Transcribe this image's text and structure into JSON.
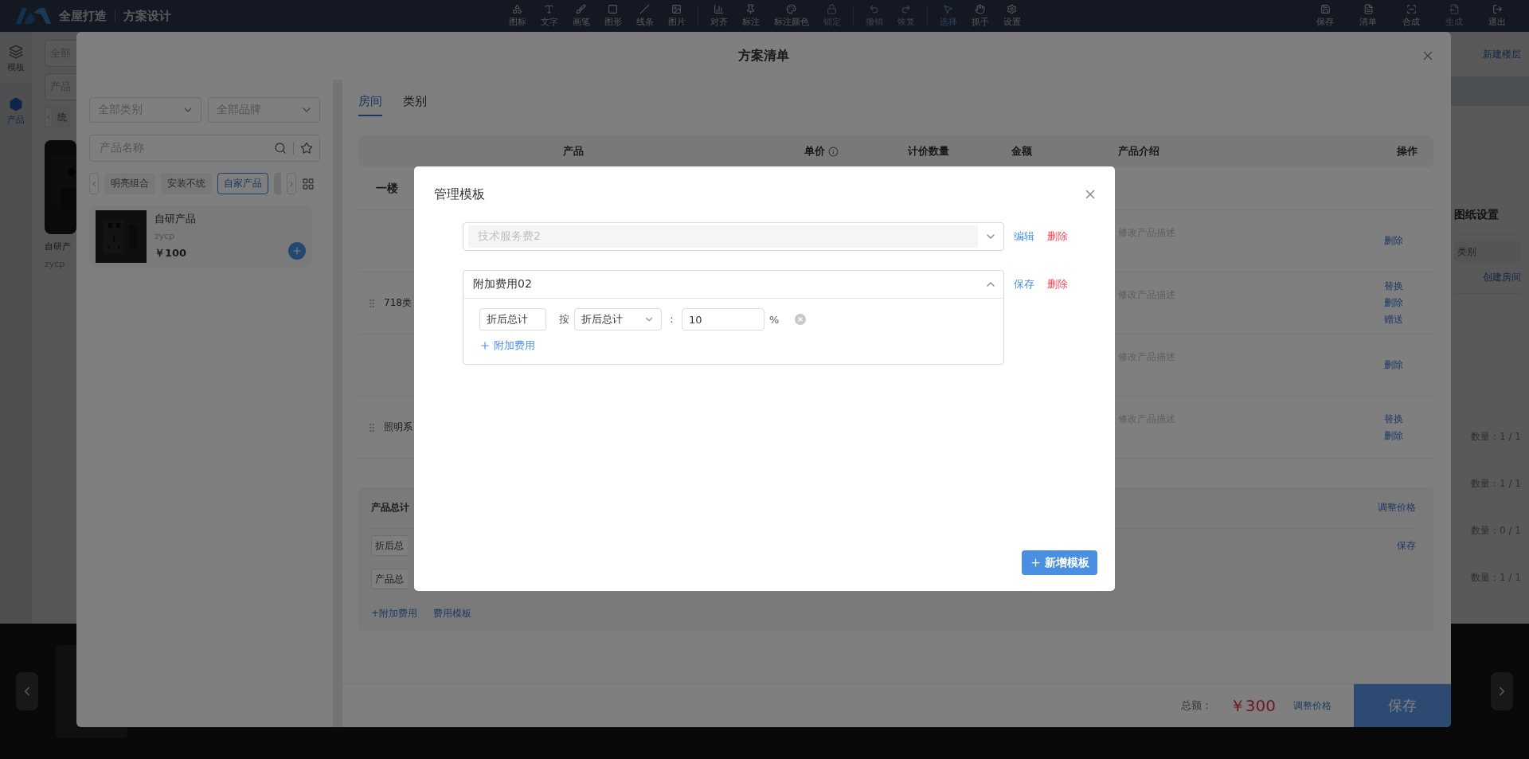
{
  "app": {
    "brand": "全屋打造",
    "subtitle": "方案设计",
    "tool_groups": [
      {
        "tools": [
          {
            "label": "图标",
            "selected": false,
            "disabled": false
          },
          {
            "label": "文字",
            "selected": false,
            "disabled": false
          },
          {
            "label": "画笔",
            "selected": false,
            "disabled": false
          },
          {
            "label": "图形",
            "selected": false,
            "disabled": false
          },
          {
            "label": "线条",
            "selected": false,
            "disabled": false
          },
          {
            "label": "图片",
            "selected": false,
            "disabled": false
          }
        ]
      },
      {
        "tools": [
          {
            "label": "对齐",
            "selected": false,
            "disabled": false
          },
          {
            "label": "标注",
            "selected": false,
            "disabled": false
          },
          {
            "label": "标注颜色",
            "selected": false,
            "disabled": false
          },
          {
            "label": "锁定",
            "selected": false,
            "disabled": true
          }
        ]
      },
      {
        "tools": [
          {
            "label": "撤销",
            "selected": false,
            "disabled": true
          },
          {
            "label": "恢复",
            "selected": false,
            "disabled": true
          }
        ]
      },
      {
        "tools": [
          {
            "label": "选择",
            "selected": true,
            "disabled": false
          },
          {
            "label": "抓手",
            "selected": false,
            "disabled": false
          },
          {
            "label": "设置",
            "selected": false,
            "disabled": false
          }
        ]
      }
    ],
    "actions": [
      {
        "label": "保存",
        "disabled": false
      },
      {
        "label": "清单",
        "disabled": false
      },
      {
        "label": "合成",
        "disabled": false
      },
      {
        "label": "生成",
        "disabled": true
      },
      {
        "label": "退出",
        "disabled": false
      }
    ],
    "sidebar": [
      {
        "label": "模板",
        "selected": false
      },
      {
        "label": "产品",
        "selected": true
      }
    ],
    "library": {
      "category_placeholder": "全部",
      "search_placeholder": "产品",
      "chip": "统",
      "card": {
        "name": "自研产",
        "code": "zycp"
      }
    },
    "floor_panel": {
      "new_floor": "新建楼层",
      "title": "图纸设置",
      "category_placeholder": "类别",
      "create_room": "创建房间",
      "quantities": [
        "数量：1 / 1",
        "数量：1 / 1",
        "数量：0 / 1",
        "数量：1 / 1"
      ]
    }
  },
  "plan_dialog": {
    "title": "方案清单",
    "filters": {
      "category_placeholder": "全部类别",
      "brand_placeholder": "全部品牌",
      "search_placeholder": "产品名称"
    },
    "chips": [
      {
        "label": "明亮组合",
        "selected": false
      },
      {
        "label": "安装不统",
        "selected": false
      },
      {
        "label": "自家产品",
        "selected": true
      }
    ],
    "product": {
      "name": "自研产品",
      "code": "zycp",
      "price": "￥100"
    },
    "tabs": [
      {
        "label": "房间",
        "selected": true
      },
      {
        "label": "类别",
        "selected": false
      }
    ],
    "table": {
      "columns": [
        {
          "label": "产品",
          "info": false
        },
        {
          "label": "单价",
          "info": true
        },
        {
          "label": "计价数量",
          "info": false
        },
        {
          "label": "金额",
          "info": false
        },
        {
          "label": "产品介绍",
          "info": false
        },
        {
          "label": "操作",
          "info": false
        }
      ],
      "rows": [
        {
          "kind": "group",
          "label": "一楼"
        },
        {
          "kind": "item",
          "description": "修改产品描述",
          "actions": [
            "删除"
          ]
        },
        {
          "kind": "item",
          "name": "718类",
          "description": "修改产品描述",
          "actions": [
            "替换",
            "删除",
            "赠送"
          ]
        },
        {
          "kind": "item",
          "description": "修改产品描述",
          "actions": [
            "删除"
          ]
        },
        {
          "kind": "item",
          "name": "照明系",
          "description": "修改产品描述",
          "actions": [
            "替换",
            "删除"
          ]
        }
      ]
    },
    "summary": {
      "title": "产品总计",
      "adjust": "调整价格",
      "fields": [
        {
          "value": "折后总"
        },
        {
          "value": "产品总"
        }
      ],
      "save": "保存",
      "links": [
        "+附加费用",
        "费用模板"
      ]
    },
    "footer": {
      "total_label": "总额：",
      "total": "￥300",
      "adjust": "调整价格",
      "save": "保存"
    }
  },
  "template_dialog": {
    "title": "管理模板",
    "templates": [
      {
        "name": "技术服务费2",
        "expanded": false,
        "actions": [
          {
            "label": "编辑",
            "kind": "link"
          },
          {
            "label": "删除",
            "kind": "danger"
          }
        ]
      },
      {
        "name": "附加费用02",
        "expanded": true,
        "actions": [
          {
            "label": "保存",
            "kind": "link"
          },
          {
            "label": "删除",
            "kind": "danger"
          }
        ],
        "fees": [
          {
            "name": "折后总计",
            "by": "按",
            "basis": "折后总计",
            "colon": "：",
            "value": "10",
            "unit": "%"
          }
        ],
        "add_fee": "附加费用"
      }
    ],
    "add_button": "新增模板"
  }
}
